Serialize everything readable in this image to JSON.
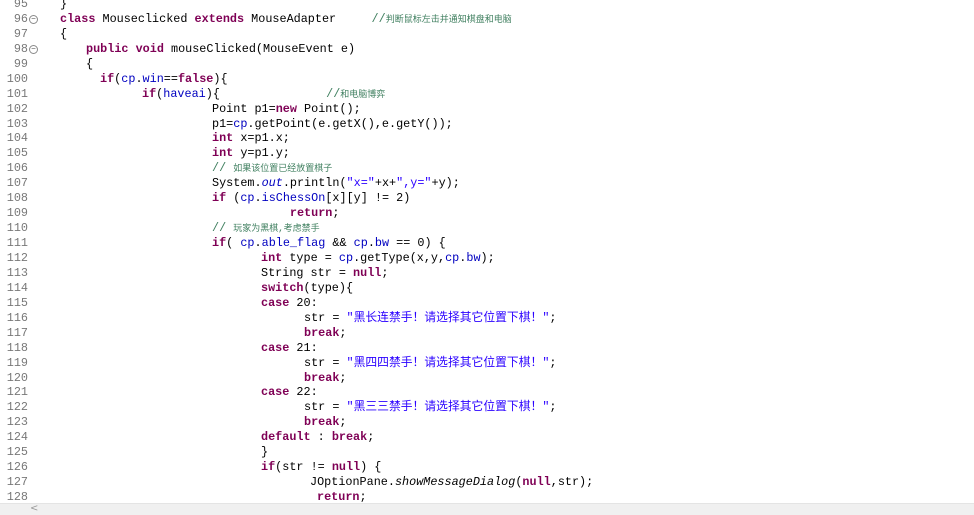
{
  "editor": {
    "lines": [
      {
        "num": "95",
        "fold": false,
        "tokens": [
          [
            "plain",
            "}"
          ]
        ]
      },
      {
        "num": "96",
        "fold": true,
        "tokens": [
          [
            "kw",
            "class"
          ],
          [
            "plain",
            " Mouseclicked "
          ],
          [
            "kw",
            "extends"
          ],
          [
            "plain",
            " MouseAdapter     "
          ],
          [
            "cmt",
            "//"
          ],
          [
            "cm",
            "判断鼠标左击并通知棋盘和电脑"
          ]
        ]
      },
      {
        "num": "97",
        "fold": false,
        "tokens": [
          [
            "plain",
            "{"
          ]
        ]
      },
      {
        "num": "98",
        "fold": true,
        "tokens": [
          [
            "kw",
            "public"
          ],
          [
            "plain",
            " "
          ],
          [
            "kw",
            "void"
          ],
          [
            "plain",
            " mouseClicked(MouseEvent e)"
          ]
        ]
      },
      {
        "num": "99",
        "fold": false,
        "tokens": [
          [
            "plain",
            "{"
          ]
        ]
      },
      {
        "num": "100",
        "fold": false,
        "tokens": [
          [
            "kw",
            "if"
          ],
          [
            "plain",
            "("
          ],
          [
            "field",
            "cp"
          ],
          [
            "plain",
            "."
          ],
          [
            "field",
            "win"
          ],
          [
            "plain",
            "=="
          ],
          [
            "kw",
            "false"
          ],
          [
            "plain",
            "){"
          ]
        ]
      },
      {
        "num": "101",
        "fold": false,
        "tokens": [
          [
            "kw",
            "if"
          ],
          [
            "plain",
            "("
          ],
          [
            "field",
            "haveai"
          ],
          [
            "plain",
            "){               "
          ],
          [
            "cmt",
            "//"
          ],
          [
            "cm",
            "和电脑博弈"
          ]
        ]
      },
      {
        "num": "102",
        "fold": false,
        "tokens": [
          [
            "plain",
            "Point p1="
          ],
          [
            "kw",
            "new"
          ],
          [
            "plain",
            " Point();"
          ]
        ]
      },
      {
        "num": "103",
        "fold": false,
        "tokens": [
          [
            "plain",
            "p1="
          ],
          [
            "field",
            "cp"
          ],
          [
            "plain",
            ".getPoint(e.getX(),e.getY());"
          ]
        ]
      },
      {
        "num": "104",
        "fold": false,
        "tokens": [
          [
            "kw",
            "int"
          ],
          [
            "plain",
            " x=p1.x;"
          ]
        ]
      },
      {
        "num": "105",
        "fold": false,
        "tokens": [
          [
            "kw",
            "int"
          ],
          [
            "plain",
            " y=p1.y;"
          ]
        ]
      },
      {
        "num": "106",
        "fold": false,
        "tokens": [
          [
            "cmt",
            "// "
          ],
          [
            "cm",
            "如果该位置已经放置棋子"
          ]
        ]
      },
      {
        "num": "107",
        "fold": false,
        "tokens": [
          [
            "plain",
            "System."
          ],
          [
            "static",
            "out"
          ],
          [
            "plain",
            ".println("
          ],
          [
            "str",
            "\"x=\""
          ],
          [
            "plain",
            "+x+"
          ],
          [
            "str",
            "\",y=\""
          ],
          [
            "plain",
            "+y);"
          ]
        ]
      },
      {
        "num": "108",
        "fold": false,
        "tokens": [
          [
            "kw",
            "if"
          ],
          [
            "plain",
            " ("
          ],
          [
            "field",
            "cp"
          ],
          [
            "plain",
            "."
          ],
          [
            "field",
            "isChessOn"
          ],
          [
            "plain",
            "[x][y] != 2)"
          ]
        ]
      },
      {
        "num": "109",
        "fold": false,
        "tokens": [
          [
            "plain",
            "           "
          ],
          [
            "kw",
            "return"
          ],
          [
            "plain",
            ";"
          ]
        ]
      },
      {
        "num": "110",
        "fold": false,
        "tokens": [
          [
            "cmt",
            "// "
          ],
          [
            "cm",
            "玩家为黑棋,考虑禁手"
          ]
        ]
      },
      {
        "num": "111",
        "fold": false,
        "tokens": [
          [
            "kw",
            "if"
          ],
          [
            "plain",
            "( "
          ],
          [
            "field",
            "cp"
          ],
          [
            "plain",
            "."
          ],
          [
            "field",
            "able_flag"
          ],
          [
            "plain",
            " && "
          ],
          [
            "field",
            "cp"
          ],
          [
            "plain",
            "."
          ],
          [
            "field",
            "bw"
          ],
          [
            "plain",
            " == 0) {"
          ]
        ]
      },
      {
        "num": "112",
        "fold": false,
        "tokens": [
          [
            "kw",
            "int"
          ],
          [
            "plain",
            " type = "
          ],
          [
            "field",
            "cp"
          ],
          [
            "plain",
            ".getType(x,y,"
          ],
          [
            "field",
            "cp"
          ],
          [
            "plain",
            "."
          ],
          [
            "field",
            "bw"
          ],
          [
            "plain",
            ");"
          ]
        ]
      },
      {
        "num": "113",
        "fold": false,
        "tokens": [
          [
            "plain",
            "String str = "
          ],
          [
            "kw",
            "null"
          ],
          [
            "plain",
            ";"
          ]
        ]
      },
      {
        "num": "114",
        "fold": false,
        "tokens": [
          [
            "kw",
            "switch"
          ],
          [
            "plain",
            "(type){"
          ]
        ]
      },
      {
        "num": "115",
        "fold": false,
        "tokens": [
          [
            "kw",
            "case"
          ],
          [
            "plain",
            " 20:"
          ]
        ]
      },
      {
        "num": "116",
        "fold": false,
        "tokens": [
          [
            "plain",
            "str = "
          ],
          [
            "str",
            "\"黑长连禁手！请选择其它位置下棋！\""
          ],
          [
            "plain",
            ";"
          ]
        ]
      },
      {
        "num": "117",
        "fold": false,
        "tokens": [
          [
            "kw",
            "break"
          ],
          [
            "plain",
            ";"
          ]
        ]
      },
      {
        "num": "118",
        "fold": false,
        "tokens": [
          [
            "kw",
            "case"
          ],
          [
            "plain",
            " 21:"
          ]
        ]
      },
      {
        "num": "119",
        "fold": false,
        "tokens": [
          [
            "plain",
            "str = "
          ],
          [
            "str",
            "\"黑四四禁手！请选择其它位置下棋！\""
          ],
          [
            "plain",
            ";"
          ]
        ]
      },
      {
        "num": "120",
        "fold": false,
        "tokens": [
          [
            "kw",
            "break"
          ],
          [
            "plain",
            ";"
          ]
        ]
      },
      {
        "num": "121",
        "fold": false,
        "tokens": [
          [
            "kw",
            "case"
          ],
          [
            "plain",
            " 22:"
          ]
        ]
      },
      {
        "num": "122",
        "fold": false,
        "tokens": [
          [
            "plain",
            "str = "
          ],
          [
            "str",
            "\"黑三三禁手！请选择其它位置下棋！\""
          ],
          [
            "plain",
            ";"
          ]
        ]
      },
      {
        "num": "123",
        "fold": false,
        "tokens": [
          [
            "kw",
            "break"
          ],
          [
            "plain",
            ";"
          ]
        ]
      },
      {
        "num": "124",
        "fold": false,
        "tokens": [
          [
            "kw",
            "default"
          ],
          [
            "plain",
            " : "
          ],
          [
            "kw",
            "break"
          ],
          [
            "plain",
            ";"
          ]
        ]
      },
      {
        "num": "125",
        "fold": false,
        "tokens": [
          [
            "plain",
            "}"
          ]
        ]
      },
      {
        "num": "126",
        "fold": false,
        "tokens": [
          [
            "kw",
            "if"
          ],
          [
            "plain",
            "(str != "
          ],
          [
            "kw",
            "null"
          ],
          [
            "plain",
            ") {"
          ]
        ]
      },
      {
        "num": "127",
        "fold": false,
        "tokens": [
          [
            "plain",
            "JOptionPane."
          ],
          [
            "italic",
            "showMessageDialog"
          ],
          [
            "plain",
            "("
          ],
          [
            "kw",
            "null"
          ],
          [
            "plain",
            ",str);"
          ]
        ]
      },
      {
        "num": "128",
        "fold": false,
        "tokens": [
          [
            "kw",
            "return"
          ],
          [
            "plain",
            ";"
          ]
        ]
      }
    ]
  },
  "scrollbar": {
    "left_arrow": "<"
  },
  "colors": {
    "keyword": "#7f0055",
    "field": "#0000c0",
    "string": "#2a00ff",
    "comment": "#3f7f5f",
    "line_number": "#787878"
  }
}
